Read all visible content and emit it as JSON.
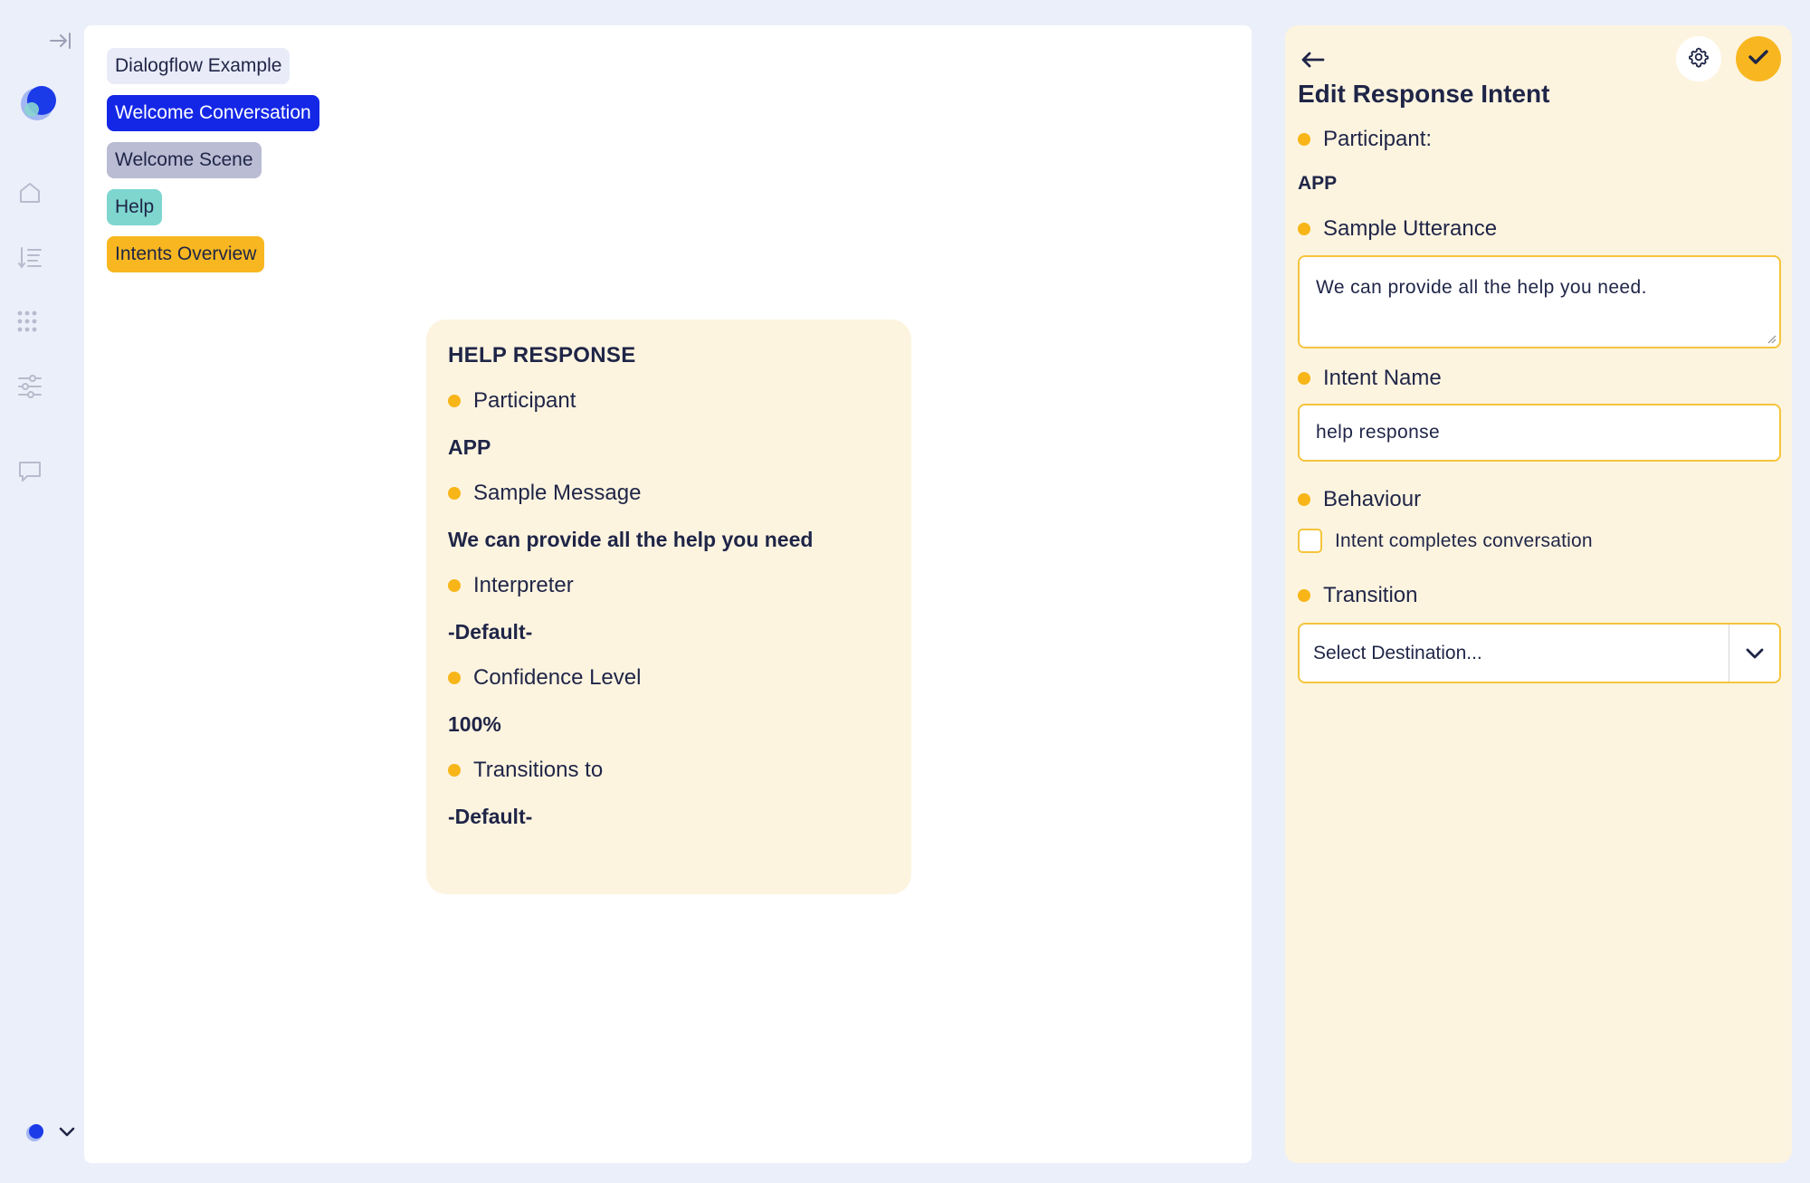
{
  "breadcrumbs": [
    {
      "label": "Dialogflow Example"
    },
    {
      "label": "Welcome Conversation"
    },
    {
      "label": "Welcome Scene"
    },
    {
      "label": "Help"
    },
    {
      "label": "Intents Overview"
    }
  ],
  "node": {
    "title": "HELP RESPONSE",
    "participant_label": "Participant",
    "participant_value": "APP",
    "message_label": "Sample Message",
    "message_value": "We can provide all the help you need",
    "interpreter_label": "Interpreter",
    "interpreter_value": "-Default-",
    "confidence_label": "Confidence Level",
    "confidence_value": "100%",
    "transitions_label": "Transitions to",
    "transitions_value": "-Default-"
  },
  "panel": {
    "title": "Edit Response Intent",
    "participant_label": "Participant:",
    "participant_value": "APP",
    "utterance_label": "Sample Utterance",
    "utterance_value": "We can provide all the help you need.",
    "intent_name_label": "Intent Name",
    "intent_name_value": "help response",
    "behaviour_label": "Behaviour",
    "completes_label": "Intent completes conversation",
    "completes_checked": false,
    "transition_label": "Transition",
    "destination_placeholder": "Select Destination..."
  },
  "colors": {
    "accent_yellow": "#f8b720",
    "primary_blue": "#1427e6",
    "panel_bg": "#fdf4e0",
    "app_bg": "#ebeff9"
  },
  "icons": {
    "rail": [
      "collapse-icon",
      "logo-icon",
      "home-icon",
      "sort-list-icon",
      "dots-grid-icon",
      "sliders-icon",
      "chat-icon",
      "workspace-logo-icon",
      "chevron-down-icon"
    ],
    "panel": [
      "back-arrow-icon",
      "gear-icon",
      "check-icon",
      "resize-grip-icon",
      "chevron-down-icon"
    ]
  }
}
